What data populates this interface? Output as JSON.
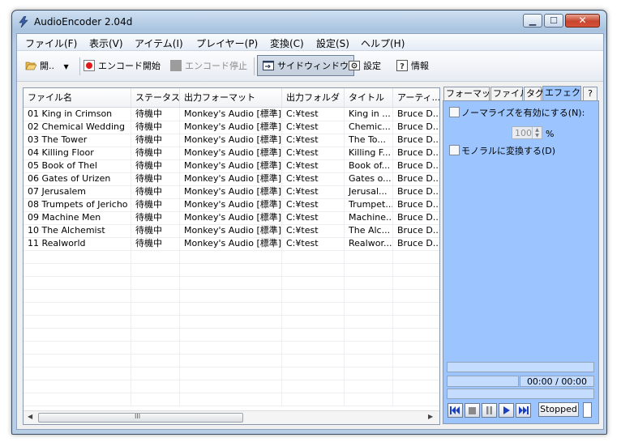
{
  "window": {
    "title": "AudioEncoder 2.04d"
  },
  "menubar": [
    {
      "label": "ファイル(F)"
    },
    {
      "label": "表示(V)"
    },
    {
      "label": "アイテム(I)"
    },
    {
      "label": "プレイヤー(P)"
    },
    {
      "label": "変換(C)"
    },
    {
      "label": "設定(S)"
    },
    {
      "label": "ヘルプ(H)"
    }
  ],
  "toolbar": {
    "open_label": "開..",
    "encode_start_label": "エンコード開始",
    "encode_stop_label": "エンコード停止",
    "side_window_label": "サイドウィンドウ",
    "settings_label": "設定",
    "info_label": "情報"
  },
  "table": {
    "columns": [
      "ファイル名",
      "ステータス",
      "出力フォーマット",
      "出力フォルダ",
      "タイトル",
      "アーティ..."
    ],
    "rows": [
      [
        "01 King in Crimson",
        "待機中",
        "Monkey's Audio [標準]",
        "C:¥test",
        "King in ...",
        "Bruce D..."
      ],
      [
        "02 Chemical Wedding",
        "待機中",
        "Monkey's Audio [標準]",
        "C:¥test",
        "Chemic...",
        "Bruce D..."
      ],
      [
        "03 The Tower",
        "待機中",
        "Monkey's Audio [標準]",
        "C:¥test",
        "The To...",
        "Bruce D..."
      ],
      [
        "04 Killing Floor",
        "待機中",
        "Monkey's Audio [標準]",
        "C:¥test",
        "Killing F...",
        "Bruce D..."
      ],
      [
        "05 Book of Thel",
        "待機中",
        "Monkey's Audio [標準]",
        "C:¥test",
        "Book of...",
        "Bruce D..."
      ],
      [
        "06 Gates of Urizen",
        "待機中",
        "Monkey's Audio [標準]",
        "C:¥test",
        "Gates o...",
        "Bruce D..."
      ],
      [
        "07 Jerusalem",
        "待機中",
        "Monkey's Audio [標準]",
        "C:¥test",
        "Jerusal...",
        "Bruce D..."
      ],
      [
        "08 Trumpets of Jericho",
        "待機中",
        "Monkey's Audio [標準]",
        "C:¥test",
        "Trumpet...",
        "Bruce D..."
      ],
      [
        "09 Machine Men",
        "待機中",
        "Monkey's Audio [標準]",
        "C:¥test",
        "Machine...",
        "Bruce D..."
      ],
      [
        "10 The Alchemist",
        "待機中",
        "Monkey's Audio [標準]",
        "C:¥test",
        "The Alc...",
        "Bruce D..."
      ],
      [
        "11 Realworld",
        "待機中",
        "Monkey's Audio [標準]",
        "C:¥test",
        "Realwor...",
        "Bruce D..."
      ]
    ]
  },
  "scrollbar": {
    "thumb_glyph": "III"
  },
  "side": {
    "tabs": [
      "フォーマット",
      "ファイル",
      "タグ",
      "エフェクト",
      "?"
    ],
    "active_tab": "エフェクト",
    "normalize_label": "ノーマライズを有効にする(N):",
    "normalize_value": "100",
    "normalize_unit": "%",
    "mono_label": "モノラルに変換する(D)",
    "time_display": "00:00 / 00:00",
    "player_status": "Stopped"
  },
  "colors": {
    "panel_bg": "#9cc5ff",
    "player_icon": "#1a3fc0",
    "record_red": "#e01818"
  }
}
